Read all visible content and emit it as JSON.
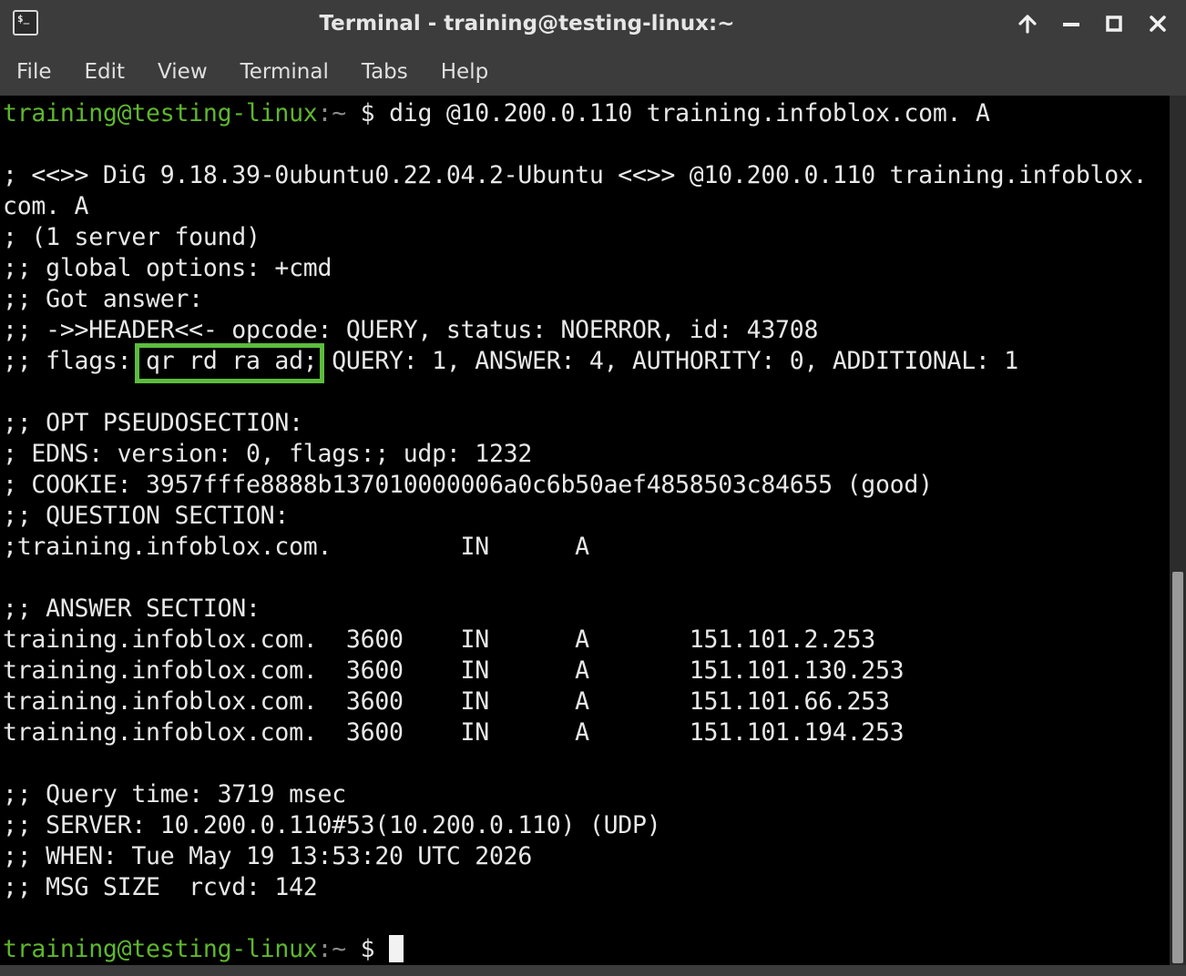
{
  "window": {
    "title": "Terminal - training@testing-linux:~",
    "icon": "terminal-icon",
    "icon_glyph": "$_",
    "controls": [
      "arrow-up-icon",
      "minimize-icon",
      "maximize-icon",
      "close-icon"
    ]
  },
  "menu": {
    "items": [
      "File",
      "Edit",
      "View",
      "Terminal",
      "Tabs",
      "Help"
    ]
  },
  "terminal": {
    "prompt_user": "training@testing-linux",
    "prompt_path": ":~",
    "prompt_symbol": "$",
    "command": "dig @10.200.0.110 training.infoblox.com. A",
    "output_top": "\n; <<>> DiG 9.18.39-0ubuntu0.22.04.2-Ubuntu <<>> @10.200.0.110 training.infoblox.\ncom. A\n; (1 server found)\n;; global options: +cmd\n;; Got answer:\n;; ->>HEADER<<- opcode: QUERY, status: NOERROR, id: 43708",
    "flags_prefix": ";; flags: ",
    "flags_value": "qr rd ra ad;",
    "flags_suffix": " QUERY: 1, ANSWER: 4, AUTHORITY: 0, ADDITIONAL: 1",
    "output_bottom": "\n;; OPT PSEUDOSECTION:\n; EDNS: version: 0, flags:; udp: 1232\n; COOKIE: 3957fffe8888b137010000006a0c6b50aef4858503c84655 (good)\n;; QUESTION SECTION:\n;training.infoblox.com.         IN      A\n\n;; ANSWER SECTION:\ntraining.infoblox.com.  3600    IN      A       151.101.2.253\ntraining.infoblox.com.  3600    IN      A       151.101.130.253\ntraining.infoblox.com.  3600    IN      A       151.101.66.253\ntraining.infoblox.com.  3600    IN      A       151.101.194.253\n\n;; Query time: 3719 msec\n;; SERVER: 10.200.0.110#53(10.200.0.110) (UDP)\n;; WHEN: Tue May 19 13:53:20 UTC 2026\n;; MSG SIZE  rcvd: 142\n",
    "highlight_color": "#5cbc3e",
    "prompt_color": "#5fb62e"
  }
}
